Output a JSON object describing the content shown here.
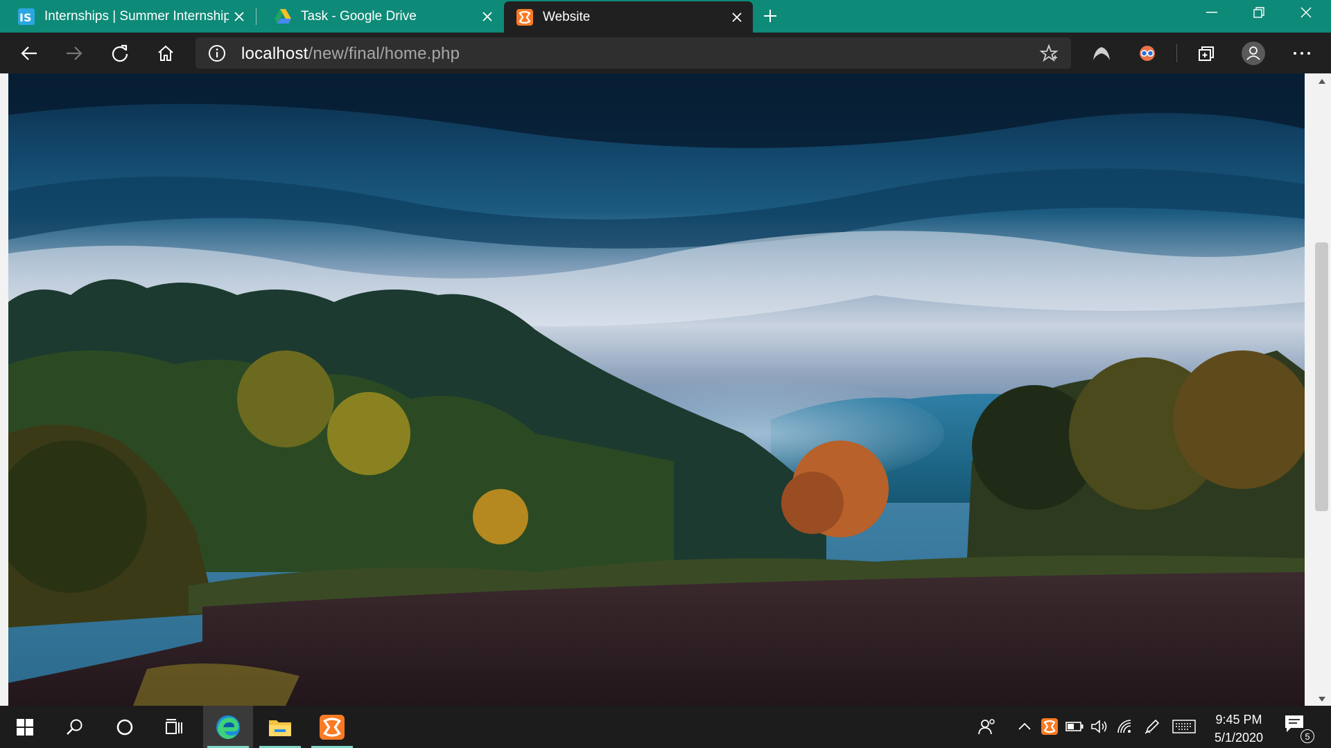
{
  "browser": {
    "tabs": [
      {
        "title": "Internships | Summer Internship",
        "favicon": "internshala-icon"
      },
      {
        "title": "Task - Google Drive",
        "favicon": "google-drive-icon"
      },
      {
        "title": "Website",
        "favicon": "xampp-icon",
        "active": true
      }
    ],
    "address": {
      "host": "localhost",
      "path": "/new/final/home.php"
    },
    "toolbar_icons": [
      "back-icon",
      "forward-icon",
      "refresh-icon",
      "home-icon",
      "site-info-icon",
      "favorite-star-icon",
      "extension-icon",
      "extension-2-icon",
      "collections-icon",
      "profile-icon",
      "more-icon"
    ],
    "accent": "#0e8a78"
  },
  "page": {
    "hero_image": "landscape-photo: stormy blue sky over misty forested hills and a plowed field"
  },
  "taskbar": {
    "apps": [
      "start-icon",
      "search-icon",
      "cortana-icon",
      "task-view-icon",
      "edge-icon",
      "file-explorer-icon",
      "xampp-icon"
    ],
    "tray": [
      "people-icon",
      "show-hidden-icon",
      "xampp-tray-icon",
      "battery-icon",
      "volume-icon",
      "wifi-icon",
      "pen-icon",
      "keyboard-icon"
    ],
    "time": "9:45 PM",
    "date": "5/1/2020",
    "notification_count": "5"
  }
}
